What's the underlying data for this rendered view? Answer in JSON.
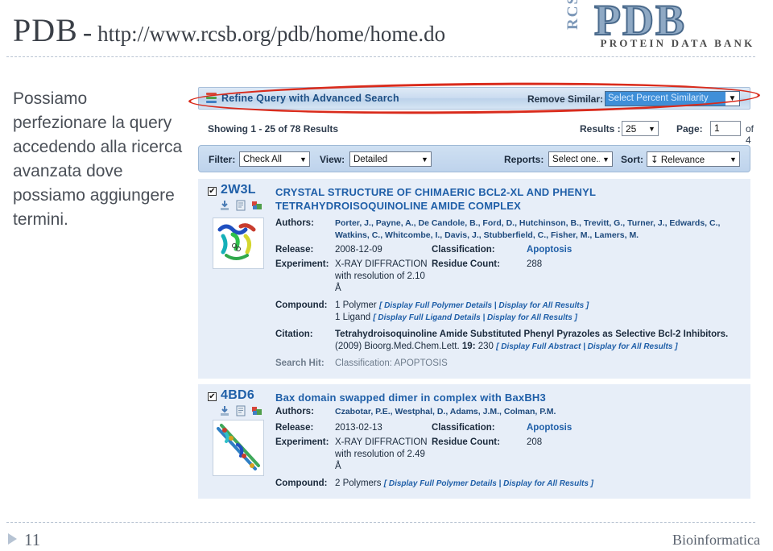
{
  "slide": {
    "title_main": "PDB",
    "title_dash": "-",
    "title_url": "http://www.rcsb.org/pdb/home/home.do",
    "narration": "Possiamo perfezionare la query accedendo alla ricerca avanzata dove possiamo aggiungere termini.",
    "footer_page": "11",
    "footer_right": "Bioinformatica"
  },
  "logo": {
    "rcsb": "RCSB",
    "pdb": "PDB",
    "tagline": "PROTEIN DATA BANK"
  },
  "colors": {
    "link_blue": "#1f5fa8",
    "annotation_red": "#d92b1c",
    "select_highlight": "#3f8fd8",
    "panel_bg": "#e7eef8",
    "toolbar_bg": "#bed3ec"
  },
  "refine_bar": {
    "icon": "stacked-layers-icon",
    "label": "Refine Query with Advanced Search",
    "remove_similar_label": "Remove Similar:",
    "similarity_value": "Select Percent Similarity",
    "annotation": "red-ellipse-highlight"
  },
  "showing_row": {
    "showing_text": "Showing 1 - 25 of 78 Results",
    "results_label": "Results :",
    "results_value": "25",
    "page_label": "Page:",
    "page_value": "1",
    "page_total": "of 4"
  },
  "toolbar": {
    "filter_label": "Filter:",
    "filter_value": "Check All",
    "view_label": "View:",
    "view_value": "Detailed",
    "reports_label": "Reports:",
    "reports_value": "Select one...",
    "sort_label": "Sort:",
    "sort_value": "↧ Relevance"
  },
  "labels": {
    "authors": "Authors:",
    "release": "Release:",
    "classification": "Classification:",
    "experiment": "Experiment:",
    "residue_count": "Residue Count:",
    "compound": "Compound:",
    "citation": "Citation:",
    "search_hit": "Search Hit:"
  },
  "results": [
    {
      "checked": "✔",
      "pdb_id": "2W3L",
      "title": "CRYSTAL STRUCTURE OF CHIMAERIC BCL2-XL AND PHENYL TETRAHYDROISOQUINOLINE AMIDE COMPLEX",
      "authors": "Porter, J., Payne, A., De Candole, B., Ford, D., Hutchinson, B., Trevitt, G., Turner, J., Edwards, C., Watkins, C., Whitcombe, I., Davis, J., Stubberfield, C., Fisher, M., Lamers, M.",
      "release": "2008-12-09",
      "classification": "Apoptosis",
      "experiment": "X-RAY DIFFRACTION with resolution of 2.10 Å",
      "residue_count": "288",
      "compound_lines": [
        {
          "text": "1 Polymer",
          "links": "[ Display Full Polymer Details | Display for All Results ]"
        },
        {
          "text": "1 Ligand",
          "links": "[ Display Full Ligand Details | Display for All Results ]"
        }
      ],
      "citation_title": "Tetrahydroisoquinoline Amide Substituted Phenyl Pyrazoles as Selective Bcl-2 Inhibitors.",
      "citation_source": "(2009) Bioorg.Med.Chem.Lett.",
      "citation_volume": "19:",
      "citation_page": "230",
      "citation_links": "[ Display Full Abstract | Display for All Results ]",
      "search_hit": "Classification: APOPTOSIS"
    },
    {
      "checked": "✔",
      "pdb_id": "4BD6",
      "title": "Bax domain swapped dimer in complex with BaxBH3",
      "authors": "Czabotar, P.E., Westphal, D., Adams, J.M., Colman, P.M.",
      "release": "2013-02-13",
      "classification": "Apoptosis",
      "experiment": "X-RAY DIFFRACTION with resolution of 2.49 Å",
      "residue_count": "208",
      "compound_lines": [
        {
          "text": "2 Polymers",
          "links": "[ Display Full Polymer Details | Display for All Results ]"
        }
      ]
    }
  ]
}
